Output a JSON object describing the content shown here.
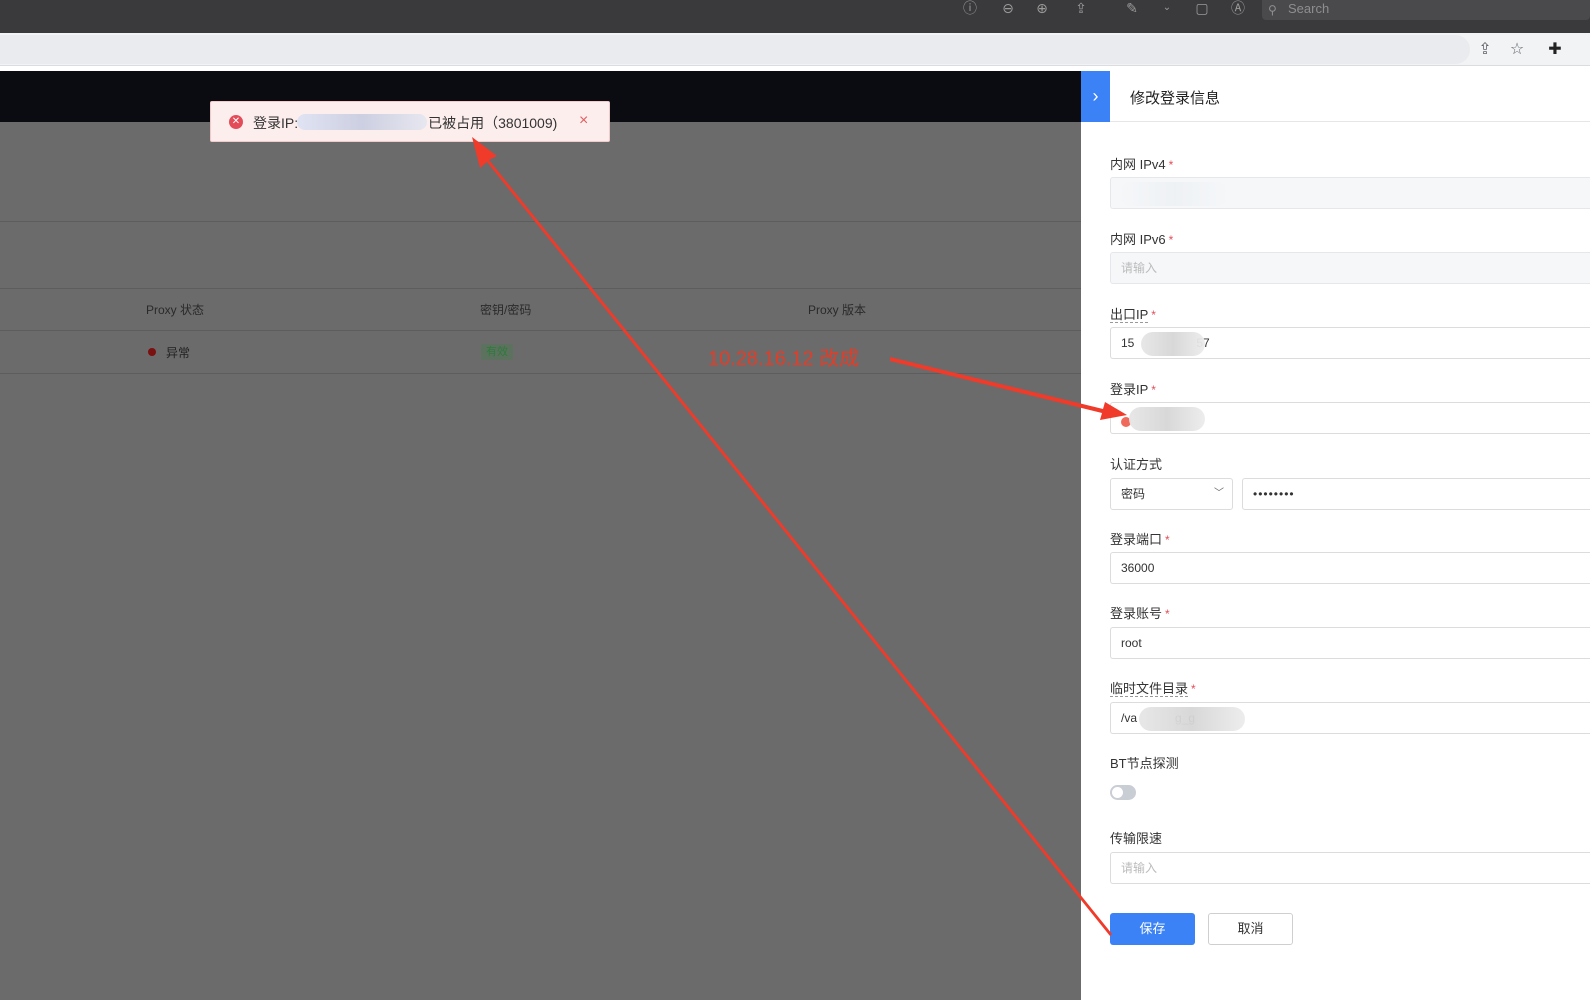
{
  "os_toolbar": {
    "search_placeholder": "Search",
    "icons": [
      "info-icon",
      "zoom-out-icon",
      "zoom-in-icon",
      "share-icon",
      "pen-icon",
      "chevron-down-icon",
      "crop-icon",
      "markup-icon"
    ]
  },
  "browser": {
    "icons": [
      "share-icon",
      "star-icon",
      "extension-icon"
    ]
  },
  "table": {
    "columns": [
      "Proxy 状态",
      "密钥/密码",
      "Proxy 版本"
    ],
    "row": {
      "status": "异常",
      "key_status": "有效"
    }
  },
  "toast": {
    "prefix": "登录IP:",
    "suffix": "已被占用（3801009)",
    "close": "×"
  },
  "drawer": {
    "toggle": "›",
    "title": "修改登录信息",
    "fields": {
      "intranet_ipv4": {
        "label": "内网 IPv4",
        "required": "*"
      },
      "intranet_ipv6": {
        "label": "内网 IPv6",
        "required": "*",
        "placeholder": "请输入"
      },
      "egress_ip": {
        "label": "出口IP",
        "required": "*",
        "value_visible": "15",
        "value_tail": "57"
      },
      "login_ip": {
        "label": "登录IP",
        "required": "*"
      },
      "auth_method": {
        "label": "认证方式",
        "selected": "密码",
        "password_mask": "••••••••"
      },
      "login_port": {
        "label": "登录端口",
        "required": "*",
        "value": "36000"
      },
      "login_account": {
        "label": "登录账号",
        "required": "*",
        "value": "root"
      },
      "temp_dir": {
        "label": "临时文件目录",
        "required": "*",
        "value_visible": "/va",
        "value_tail": "g_g"
      },
      "bt_detect": {
        "label": "BT节点探测",
        "enabled": false
      },
      "rate_limit": {
        "label": "传输限速",
        "placeholder": "请输入"
      }
    },
    "save_label": "保存",
    "cancel_label": "取消"
  },
  "annotation": {
    "text": "10.28.16.12 改成",
    "color": "#e23d28"
  }
}
